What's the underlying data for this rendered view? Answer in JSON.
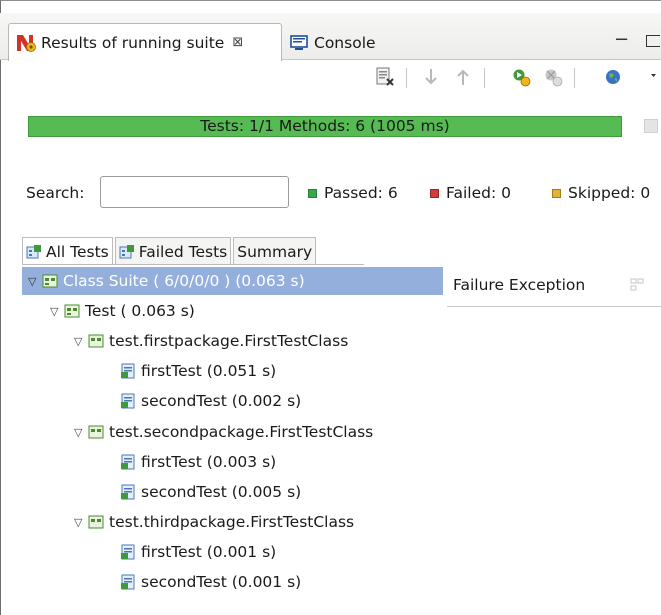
{
  "tabs": {
    "active": {
      "label": "Results of running suite",
      "icon": "testng-icon"
    },
    "inactive": {
      "label": "Console",
      "icon": "console-icon"
    }
  },
  "toolbar": {
    "icons": [
      "rerun-failed-icon",
      "next-failure-icon",
      "previous-failure-icon",
      "run-again-icon",
      "debug-again-icon",
      "globe-icon",
      "view-menu-icon"
    ]
  },
  "progress": {
    "text": "Tests: 1/1  Methods: 6 (1005 ms)",
    "fraction": 1.0,
    "color": "#56bb52"
  },
  "search": {
    "label": "Search:",
    "value": "",
    "placeholder": ""
  },
  "stats": {
    "passed": {
      "label": "Passed: 6",
      "color": "#3aa64a"
    },
    "failed": {
      "label": "Failed: 0",
      "color": "#d33a3a"
    },
    "skipped": {
      "label": "Skipped: 0",
      "color": "#e0b43a"
    }
  },
  "subtabs": [
    {
      "label": "All Tests",
      "icon": "all-tests-icon"
    },
    {
      "label": "Failed Tests",
      "icon": "failed-tests-icon"
    },
    {
      "label": "Summary"
    }
  ],
  "tree": {
    "suite": "Class Suite ( 6/0/0/0 ) (0.063 s)",
    "test": "Test ( 0.063 s)",
    "classes": [
      {
        "name": "test.firstpackage.FirstTestClass",
        "methods": [
          "firstTest  (0.051 s)",
          "secondTest  (0.002 s)"
        ]
      },
      {
        "name": "test.secondpackage.FirstTestClass",
        "methods": [
          "firstTest  (0.003 s)",
          "secondTest  (0.005 s)"
        ]
      },
      {
        "name": "test.thirdpackage.FirstTestClass",
        "methods": [
          "firstTest  (0.001 s)",
          "secondTest  (0.001 s)"
        ]
      }
    ]
  },
  "right_panel": {
    "label": "Failure Exception"
  }
}
